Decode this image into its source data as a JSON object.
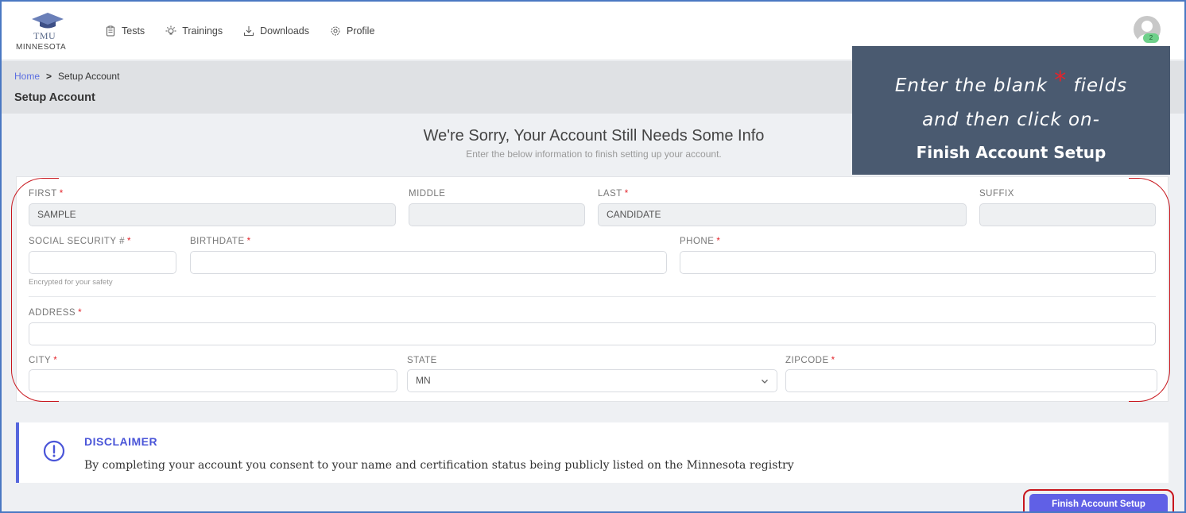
{
  "brand": {
    "name": "TMU",
    "state": "MINNESOTA"
  },
  "nav": {
    "items": [
      {
        "label": "Tests",
        "icon": "clipboard-icon"
      },
      {
        "label": "Trainings",
        "icon": "lightbulb-icon"
      },
      {
        "label": "Downloads",
        "icon": "download-icon"
      },
      {
        "label": "Profile",
        "icon": "gear-icon"
      }
    ]
  },
  "user": {
    "badge": "2"
  },
  "breadcrumb": {
    "home": "Home",
    "separator": ">",
    "current": "Setup Account"
  },
  "page_title": "Setup Account",
  "header": {
    "title": "We're Sorry, Your Account Still Needs Some Info",
    "subtitle": "Enter the below information to finish setting up your account."
  },
  "callout": {
    "line1_a": "Enter the blank",
    "star": "*",
    "line1_b": "fields",
    "line2": "and then click on-",
    "line3": "Finish Account Setup",
    "bg_color": "#4a5a70"
  },
  "form": {
    "required_mark": "*",
    "first": {
      "label": "FIRST",
      "value": "SAMPLE"
    },
    "middle": {
      "label": "MIDDLE",
      "value": ""
    },
    "last": {
      "label": "LAST",
      "value": "CANDIDATE"
    },
    "suffix": {
      "label": "SUFFIX",
      "value": ""
    },
    "ssn": {
      "label": "SOCIAL SECURITY #",
      "value": "",
      "hint": "Encrypted for your safety"
    },
    "birthdate": {
      "label": "BIRTHDATE",
      "value": ""
    },
    "phone": {
      "label": "PHONE",
      "value": ""
    },
    "address": {
      "label": "ADDRESS",
      "value": ""
    },
    "city": {
      "label": "CITY",
      "value": ""
    },
    "state": {
      "label": "STATE",
      "value": "MN"
    },
    "zipcode": {
      "label": "ZIPCODE",
      "value": ""
    }
  },
  "disclaimer": {
    "title": "DISCLAIMER",
    "text": "By completing your account you consent to your name and certification status being publicly listed on the Minnesota registry"
  },
  "actions": {
    "finish_label": "Finish Account Setup"
  },
  "colors": {
    "accent": "#6060e6",
    "required": "#e3242b",
    "annotation": "#c8161d"
  }
}
